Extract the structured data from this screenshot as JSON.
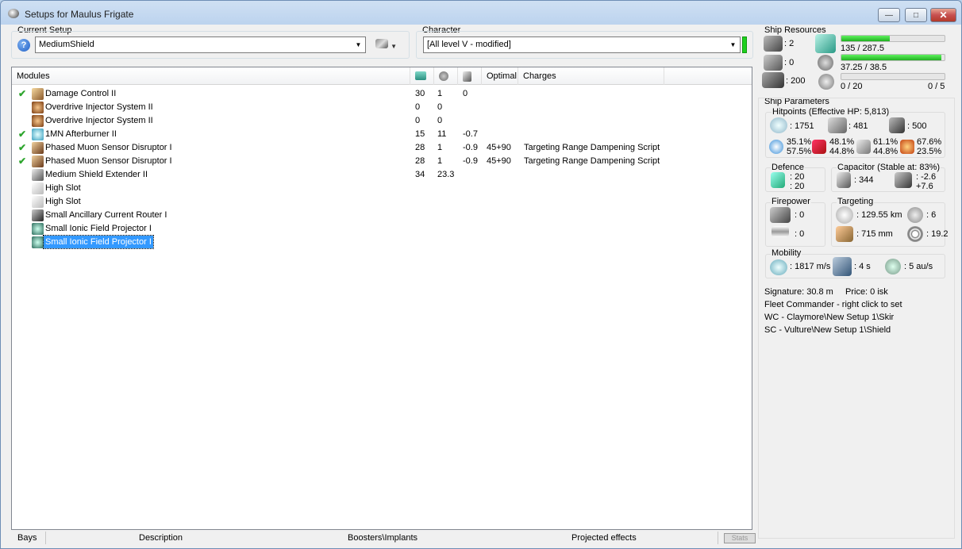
{
  "window": {
    "title": "Setups for Maulus Frigate"
  },
  "setup": {
    "label": "Current Setup",
    "value": "MediumShield"
  },
  "character": {
    "label": "Character",
    "value": "[All level V - modified]"
  },
  "modules": {
    "columns": [
      "Modules",
      "",
      "",
      "",
      "Optimal",
      "Charges"
    ],
    "rows": [
      {
        "checked": true,
        "name": "Damage Control II",
        "cpu": "30",
        "pg": "1",
        "cap": "0",
        "optimal": "",
        "charges": ""
      },
      {
        "checked": false,
        "name": "Overdrive Injector System II",
        "cpu": "0",
        "pg": "0",
        "cap": "",
        "optimal": "",
        "charges": ""
      },
      {
        "checked": false,
        "name": "Overdrive Injector System II",
        "cpu": "0",
        "pg": "0",
        "cap": "",
        "optimal": "",
        "charges": ""
      },
      {
        "checked": true,
        "name": "1MN Afterburner II",
        "cpu": "15",
        "pg": "11",
        "cap": "-0.7",
        "optimal": "",
        "charges": ""
      },
      {
        "checked": true,
        "name": "Phased Muon Sensor Disruptor I",
        "cpu": "28",
        "pg": "1",
        "cap": "-0.9",
        "optimal": "45+90",
        "charges": "Targeting Range Dampening Script"
      },
      {
        "checked": true,
        "name": "Phased Muon Sensor Disruptor I",
        "cpu": "28",
        "pg": "1",
        "cap": "-0.9",
        "optimal": "45+90",
        "charges": "Targeting Range Dampening Script"
      },
      {
        "checked": false,
        "name": "Medium Shield Extender II",
        "cpu": "34",
        "pg": "23.3",
        "cap": "",
        "optimal": "",
        "charges": ""
      },
      {
        "checked": false,
        "name": "High Slot",
        "cpu": "",
        "pg": "",
        "cap": "",
        "optimal": "",
        "charges": ""
      },
      {
        "checked": false,
        "name": "High Slot",
        "cpu": "",
        "pg": "",
        "cap": "",
        "optimal": "",
        "charges": ""
      },
      {
        "checked": false,
        "name": "Small Ancillary Current Router I",
        "cpu": "",
        "pg": "",
        "cap": "",
        "optimal": "",
        "charges": ""
      },
      {
        "checked": false,
        "name": "Small Ionic Field Projector I",
        "cpu": "",
        "pg": "",
        "cap": "",
        "optimal": "",
        "charges": ""
      },
      {
        "checked": false,
        "name": "Small Ionic Field Projector I",
        "cpu": "",
        "pg": "",
        "cap": "",
        "optimal": "",
        "charges": "",
        "selected": true
      }
    ]
  },
  "bottom_tabs": [
    "Bays",
    "Description",
    "Boosters\\Implants",
    "Projected effects",
    "Stats"
  ],
  "resources": {
    "label": "Ship Resources",
    "turrets": ": 2",
    "launchers": ": 0",
    "drone_bay": ": 200",
    "cpu_text": "135 / 287.5",
    "cpu_fraction": 0.47,
    "pg_text": "37.25 / 38.5",
    "pg_fraction": 0.97,
    "drone_bw_text": "0 / 20",
    "drones_text": "0 / 5",
    "drone_fraction": 0.0
  },
  "params": {
    "label": "Ship Parameters",
    "hitpoints_label": "Hitpoints (Effective HP: 5,813)",
    "shield_hp": ": 1751",
    "armor_hp": ": 481",
    "structure_hp": ": 500",
    "resists": [
      {
        "a": "35.1%",
        "b": "57.5%"
      },
      {
        "a": "48.1%",
        "b": "44.8%"
      },
      {
        "a": "61.1%",
        "b": "44.8%"
      },
      {
        "a": "67.6%",
        "b": "23.5%"
      }
    ],
    "defence_label": "Defence",
    "defence_a": ": 20",
    "defence_b": ": 20",
    "capacitor_label": "Capacitor (Stable at: 83%)",
    "capacitor_amount": ": 344",
    "capacitor_a": ": -2.6",
    "capacitor_b": "+7.6",
    "firepower_label": "Firepower",
    "firepower_a": ": 0",
    "firepower_b": ": 0",
    "targeting_label": "Targeting",
    "target_range": ": 129.55 km",
    "max_targets": ": 6",
    "scan_res": ": 715 mm",
    "sensor_strength": ": 19.2",
    "mobility_label": "Mobility",
    "speed": ": 1817 m/s",
    "align": ": 4 s",
    "warp": ": 5 au/s"
  },
  "info": {
    "signature": "Signature: 30.8 m",
    "price": "Price: 0 isk",
    "fleet_commander": "Fleet Commander - right click to set",
    "wing_commander": "WC - Claymore\\New Setup 1\\Skir",
    "squad_commander": "SC - Vulture\\New Setup 1\\Shield"
  },
  "colors": {
    "accent_green": "#1ed01e",
    "selection": "#3399ff",
    "check": "#2ea52e"
  }
}
